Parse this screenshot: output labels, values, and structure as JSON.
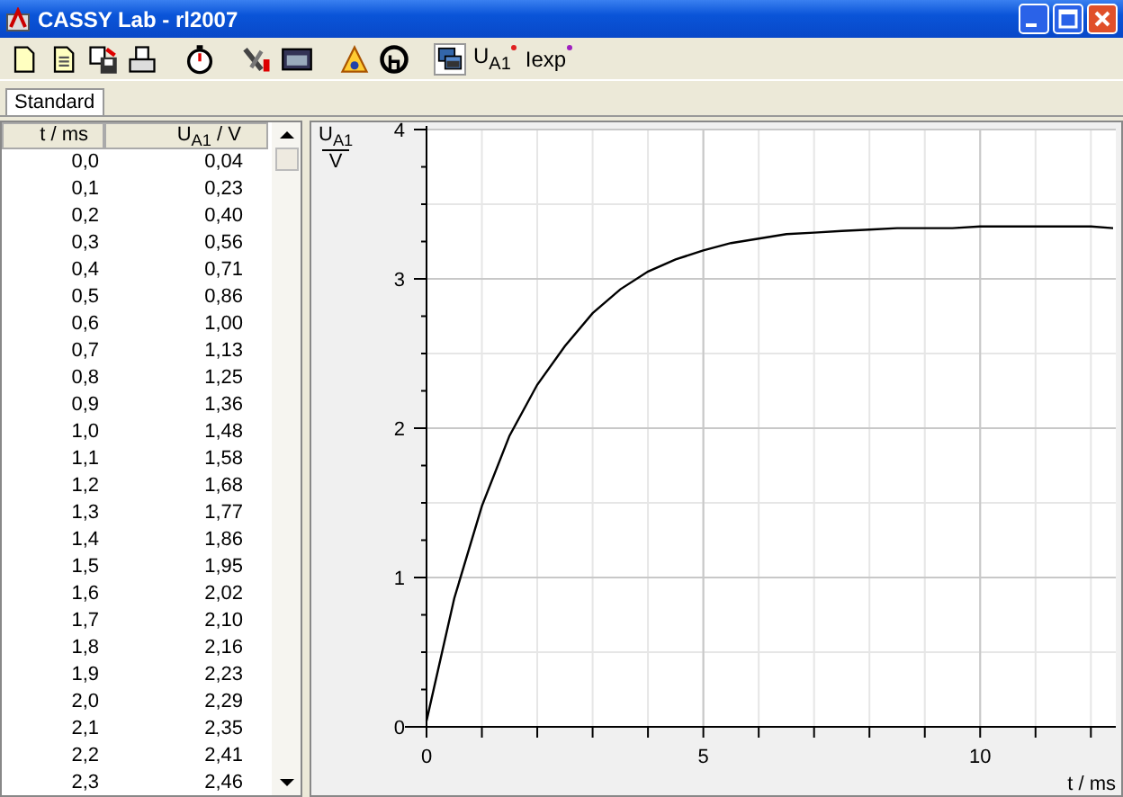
{
  "window": {
    "title": "CASSY Lab - rl2007"
  },
  "toolbar": {
    "text_buttons": [
      {
        "label": "U$_{A1}$"
      },
      {
        "label": "Iexp"
      }
    ]
  },
  "tabs": [
    {
      "label": "Standard",
      "selected": true
    }
  ],
  "table": {
    "columns": [
      "t / ms",
      "U$_{A1}$ / V"
    ],
    "rows": [
      [
        "0,0",
        "0,04"
      ],
      [
        "0,1",
        "0,23"
      ],
      [
        "0,2",
        "0,40"
      ],
      [
        "0,3",
        "0,56"
      ],
      [
        "0,4",
        "0,71"
      ],
      [
        "0,5",
        "0,86"
      ],
      [
        "0,6",
        "1,00"
      ],
      [
        "0,7",
        "1,13"
      ],
      [
        "0,8",
        "1,25"
      ],
      [
        "0,9",
        "1,36"
      ],
      [
        "1,0",
        "1,48"
      ],
      [
        "1,1",
        "1,58"
      ],
      [
        "1,2",
        "1,68"
      ],
      [
        "1,3",
        "1,77"
      ],
      [
        "1,4",
        "1,86"
      ],
      [
        "1,5",
        "1,95"
      ],
      [
        "1,6",
        "2,02"
      ],
      [
        "1,7",
        "2,10"
      ],
      [
        "1,8",
        "2,16"
      ],
      [
        "1,9",
        "2,23"
      ],
      [
        "2,0",
        "2,29"
      ],
      [
        "2,1",
        "2,35"
      ],
      [
        "2,2",
        "2,41"
      ],
      [
        "2,3",
        "2,46"
      ]
    ]
  },
  "chart": {
    "ylabel_top": "U$_{A1}$",
    "ylabel_bottom": "V",
    "chart_data": {
      "type": "line",
      "xlabel": "t / ms",
      "grid": true,
      "xlim": [
        0,
        12.45
      ],
      "ylim": [
        0,
        4
      ],
      "xticks": [
        0,
        5,
        10
      ],
      "yticks": [
        0,
        1,
        2,
        3,
        4
      ],
      "x": [
        0,
        0.5,
        1,
        1.5,
        2,
        2.5,
        3,
        3.5,
        4,
        4.5,
        5,
        5.5,
        6,
        6.5,
        7,
        7.5,
        8,
        8.5,
        9,
        9.5,
        10,
        10.5,
        11,
        11.5,
        12,
        12.4
      ],
      "series": [
        {
          "color": "#000000",
          "values": [
            0.04,
            0.86,
            1.48,
            1.95,
            2.29,
            2.55,
            2.77,
            2.93,
            3.05,
            3.13,
            3.19,
            3.24,
            3.27,
            3.3,
            3.31,
            3.32,
            3.33,
            3.34,
            3.34,
            3.34,
            3.35,
            3.35,
            3.35,
            3.35,
            3.35,
            3.34
          ]
        }
      ]
    }
  }
}
